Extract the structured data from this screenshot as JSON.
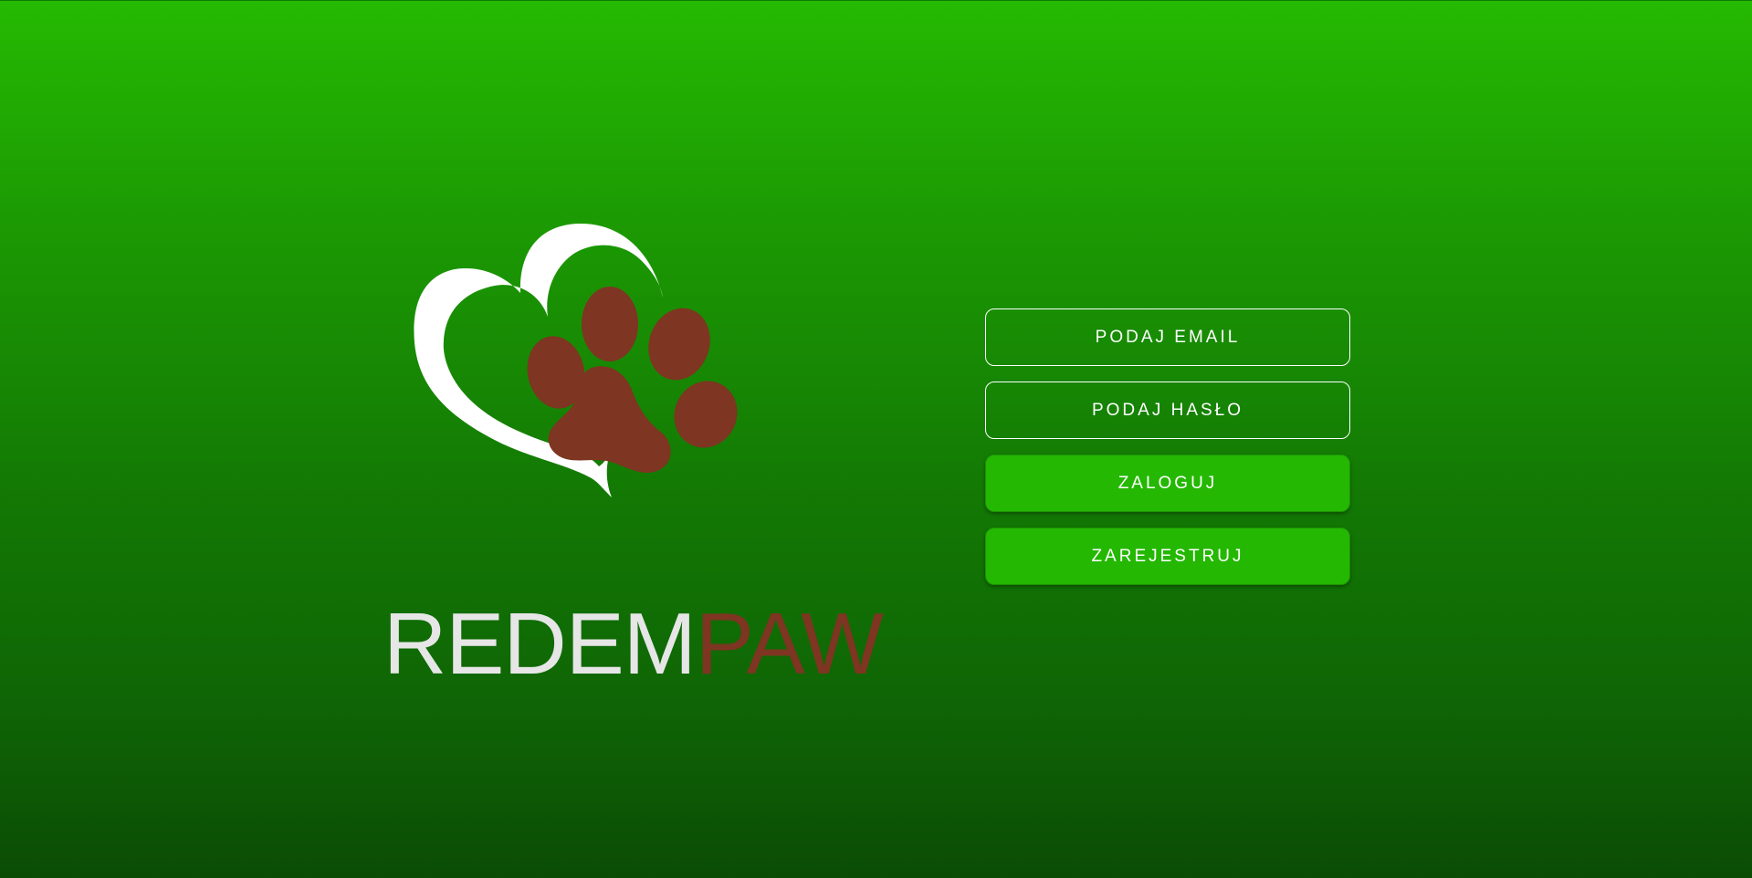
{
  "app": {
    "brand_part1": "REDEM",
    "brand_part2": "PAW"
  },
  "logo": {
    "heart_icon": "heart-outline-icon",
    "paw_icon": "paw-icon",
    "heart_color": "#ffffff",
    "paw_color": "#7e3521"
  },
  "form": {
    "email_label": "PODAJ EMAIL",
    "password_label": "PODAJ HASŁO",
    "login_label": "ZALOGUJ",
    "register_label": "ZAREJESTRUJ"
  },
  "colors": {
    "background_top": "#25ba02",
    "background_bottom": "#0b4c05",
    "accent_button": "#24b802",
    "brand_accent": "#7e3521"
  }
}
